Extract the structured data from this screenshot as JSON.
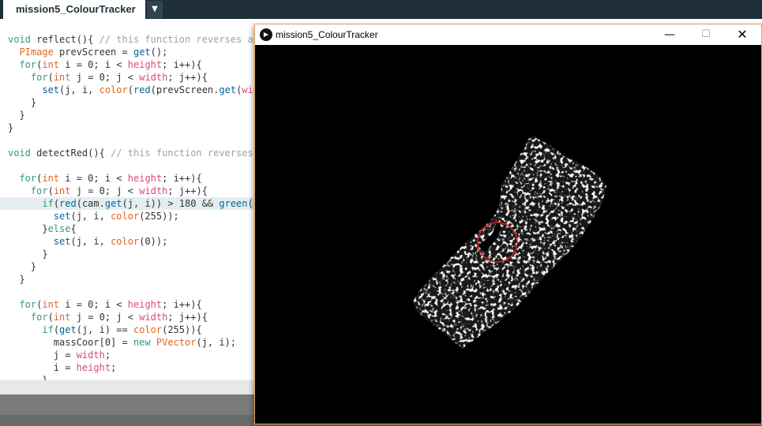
{
  "ide": {
    "tab_title": "mission5_ColourTracker",
    "tab_menu_glyph": "▼"
  },
  "code_lines": [
    [
      [
        "void",
        "k"
      ],
      [
        " reflect(){ ",
        ""
      ],
      [
        "// this function reverses all",
        "c"
      ]
    ],
    [
      [
        "  ",
        ""
      ],
      [
        "PImage",
        "ty"
      ],
      [
        " prevScreen = ",
        ""
      ],
      [
        "get",
        "f"
      ],
      [
        "();",
        ""
      ]
    ],
    [
      [
        "  ",
        ""
      ],
      [
        "for",
        "k"
      ],
      [
        "(",
        ""
      ],
      [
        "int",
        "ty"
      ],
      [
        " i = 0; i < ",
        ""
      ],
      [
        "height",
        "v"
      ],
      [
        "; i++){",
        ""
      ]
    ],
    [
      [
        "    ",
        ""
      ],
      [
        "for",
        "k"
      ],
      [
        "(",
        ""
      ],
      [
        "int",
        "ty"
      ],
      [
        " j = 0; j < ",
        ""
      ],
      [
        "width",
        "v"
      ],
      [
        "; j++){",
        ""
      ]
    ],
    [
      [
        "      ",
        ""
      ],
      [
        "set",
        "f"
      ],
      [
        "(j, i, ",
        ""
      ],
      [
        "color",
        "ty"
      ],
      [
        "(",
        ""
      ],
      [
        "red",
        "f"
      ],
      [
        "(prevScreen.",
        ""
      ],
      [
        "get",
        "f"
      ],
      [
        "(",
        ""
      ],
      [
        "widt",
        "v"
      ]
    ],
    [
      [
        "    }",
        ""
      ]
    ],
    [
      [
        "  }",
        ""
      ]
    ],
    [
      [
        "}",
        ""
      ]
    ],
    [],
    [
      [
        "void",
        "k"
      ],
      [
        " detectRed(){ ",
        ""
      ],
      [
        "// this function reverses a",
        "c"
      ]
    ],
    [],
    [
      [
        "  ",
        ""
      ],
      [
        "for",
        "k"
      ],
      [
        "(",
        ""
      ],
      [
        "int",
        "ty"
      ],
      [
        " i = 0; i < ",
        ""
      ],
      [
        "height",
        "v"
      ],
      [
        "; i++){",
        ""
      ]
    ],
    [
      [
        "    ",
        ""
      ],
      [
        "for",
        "k"
      ],
      [
        "(",
        ""
      ],
      [
        "int",
        "ty"
      ],
      [
        " j = 0; j < ",
        ""
      ],
      [
        "width",
        "v"
      ],
      [
        "; j++){",
        ""
      ]
    ],
    [
      [
        "      ",
        ""
      ],
      [
        "if",
        "k"
      ],
      [
        "(",
        ""
      ],
      [
        "red",
        "f"
      ],
      [
        "(cam.",
        ""
      ],
      [
        "get",
        "f"
      ],
      [
        "(j, i)) > 180 && ",
        ""
      ],
      [
        "green",
        "f"
      ],
      [
        "(ca",
        ""
      ]
    ],
    [
      [
        "        ",
        ""
      ],
      [
        "set",
        "f"
      ],
      [
        "(j, i, ",
        ""
      ],
      [
        "color",
        "ty"
      ],
      [
        "(255));",
        ""
      ]
    ],
    [
      [
        "      }",
        ""
      ],
      [
        "else",
        "k"
      ],
      [
        "{",
        ""
      ]
    ],
    [
      [
        "        ",
        ""
      ],
      [
        "set",
        "f"
      ],
      [
        "(j, i, ",
        ""
      ],
      [
        "color",
        "ty"
      ],
      [
        "(0));",
        ""
      ]
    ],
    [
      [
        "      }",
        ""
      ]
    ],
    [
      [
        "    }",
        ""
      ]
    ],
    [
      [
        "  }",
        ""
      ]
    ],
    [],
    [
      [
        "  ",
        ""
      ],
      [
        "for",
        "k"
      ],
      [
        "(",
        ""
      ],
      [
        "int",
        "ty"
      ],
      [
        " i = 0; i < ",
        ""
      ],
      [
        "height",
        "v"
      ],
      [
        "; i++){",
        ""
      ]
    ],
    [
      [
        "    ",
        ""
      ],
      [
        "for",
        "k"
      ],
      [
        "(",
        ""
      ],
      [
        "int",
        "ty"
      ],
      [
        " j = 0; j < ",
        ""
      ],
      [
        "width",
        "v"
      ],
      [
        "; j++){",
        ""
      ]
    ],
    [
      [
        "      ",
        ""
      ],
      [
        "if",
        "k"
      ],
      [
        "(",
        ""
      ],
      [
        "get",
        "f"
      ],
      [
        "(j, i) == ",
        ""
      ],
      [
        "color",
        "ty"
      ],
      [
        "(255)){",
        ""
      ]
    ],
    [
      [
        "        massCoor[0] = ",
        ""
      ],
      [
        "new",
        "k"
      ],
      [
        " ",
        ""
      ],
      [
        "PVector",
        "ty"
      ],
      [
        "(j, i);",
        ""
      ]
    ],
    [
      [
        "        j = ",
        ""
      ],
      [
        "width",
        "v"
      ],
      [
        ";",
        ""
      ]
    ],
    [
      [
        "        i = ",
        ""
      ],
      [
        "height",
        "v"
      ],
      [
        ";",
        ""
      ]
    ],
    [
      [
        "      }",
        ""
      ]
    ]
  ],
  "highlighted_line": 13,
  "sketch_window": {
    "title": "mission5_ColourTracker",
    "minimize_glyph": "—",
    "maximize_glyph": "☐",
    "close_glyph": "✕",
    "icon": "play-icon"
  },
  "colors": {
    "ide_dark": "#1e2f37",
    "window_border": "#e8a15a",
    "tracker_circle": "#dd2222",
    "mask_white": "#ffffff",
    "canvas_black": "#000000"
  }
}
